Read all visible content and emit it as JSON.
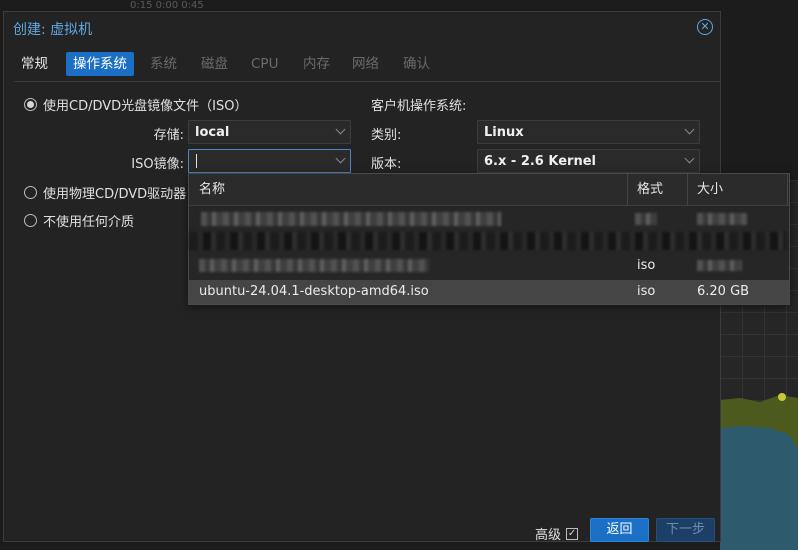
{
  "background": {
    "top_text": "0:15  0:00  0:45"
  },
  "dialog": {
    "title": "创建: 虚拟机"
  },
  "tabs": [
    {
      "label": "常规",
      "state": "done"
    },
    {
      "label": "操作系统",
      "state": "active"
    },
    {
      "label": "系统",
      "state": "disabled"
    },
    {
      "label": "磁盘",
      "state": "disabled"
    },
    {
      "label": "CPU",
      "state": "disabled"
    },
    {
      "label": "内存",
      "state": "disabled"
    },
    {
      "label": "网络",
      "state": "disabled"
    },
    {
      "label": "确认",
      "state": "disabled"
    }
  ],
  "media": {
    "option_iso": "使用CD/DVD光盘镜像文件（ISO）",
    "storage_label": "存储:",
    "storage_value": "local",
    "iso_label": "ISO镜像:",
    "iso_value": "",
    "option_physical": "使用物理CD/DVD驱动器",
    "option_none": "不使用任何介质"
  },
  "guest_os": {
    "heading": "客户机操作系统:",
    "type_label": "类别:",
    "type_value": "Linux",
    "version_label": "版本:",
    "version_value": "6.x - 2.6 Kernel"
  },
  "iso_picker": {
    "columns": [
      "名称",
      "格式",
      "大小"
    ],
    "rows": [
      {
        "name": "",
        "format": "",
        "size": "",
        "obscured": true
      },
      {
        "name": "",
        "format": "",
        "size": "",
        "obscured": true
      },
      {
        "name": "",
        "format": "iso",
        "size": "",
        "obscured": true
      },
      {
        "name": "ubuntu-24.04.1-desktop-amd64.iso",
        "format": "iso",
        "size": "6.20 GB",
        "selected": true
      }
    ]
  },
  "footer": {
    "advanced_label": "高级",
    "advanced_checked": true,
    "back_label": "返回",
    "next_label": "下一步"
  },
  "colors": {
    "accent": "#1b6fc4",
    "title": "#5fa8e4",
    "dialog_bg": "#232323",
    "selected_row": "#454545"
  }
}
